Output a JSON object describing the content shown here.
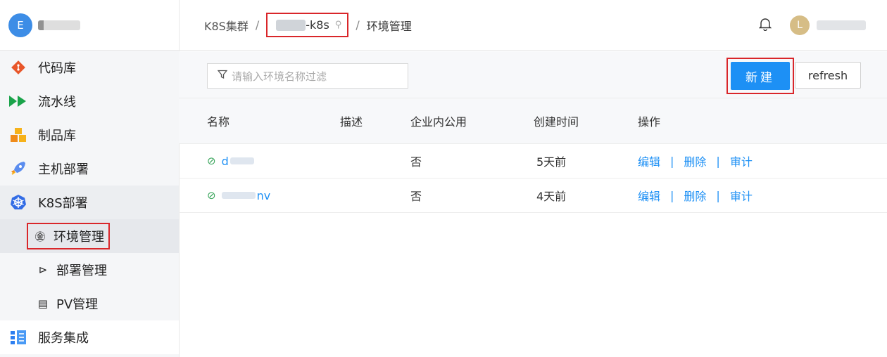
{
  "brand": {
    "avatar_letter": "E",
    "name": "e"
  },
  "sidebar": {
    "items": [
      {
        "label": "代码库",
        "icon": "git-icon"
      },
      {
        "label": "流水线",
        "icon": "pipeline-icon"
      },
      {
        "label": "制品库",
        "icon": "artifact-icon"
      },
      {
        "label": "主机部署",
        "icon": "rocket-icon"
      },
      {
        "label": "K8S部署",
        "icon": "kubernetes-icon"
      }
    ],
    "sub_items": [
      {
        "label": "环境管理",
        "icon": "namespace-icon",
        "glyph": "㊎"
      },
      {
        "label": "部署管理",
        "icon": "send-icon",
        "glyph": "⊳"
      },
      {
        "label": "PV管理",
        "icon": "storage-icon",
        "glyph": "▤"
      }
    ],
    "last_item": {
      "label": "服务集成",
      "icon": "integration-icon"
    }
  },
  "header": {
    "breadcrumb_root": "K8S集群",
    "sep": "/",
    "cluster": "-k8s",
    "current": "环境管理",
    "user_letter": "L"
  },
  "toolbar": {
    "filter_placeholder": "请输入环境名称过滤",
    "new_label": "新建",
    "refresh_label": "refresh"
  },
  "table": {
    "columns": [
      "名称",
      "描述",
      "企业内公用",
      "创建时间",
      "操作"
    ],
    "rows": [
      {
        "name": "d",
        "public": "否",
        "created": "5天前"
      },
      {
        "name": "nv",
        "public": "否",
        "created": "4天前"
      }
    ],
    "actions": [
      "编辑",
      "删除",
      "审计"
    ],
    "action_sep": "|"
  },
  "colors": {
    "primary": "#1d90f5",
    "highlight": "#d9262a",
    "success": "#3aa55c"
  }
}
